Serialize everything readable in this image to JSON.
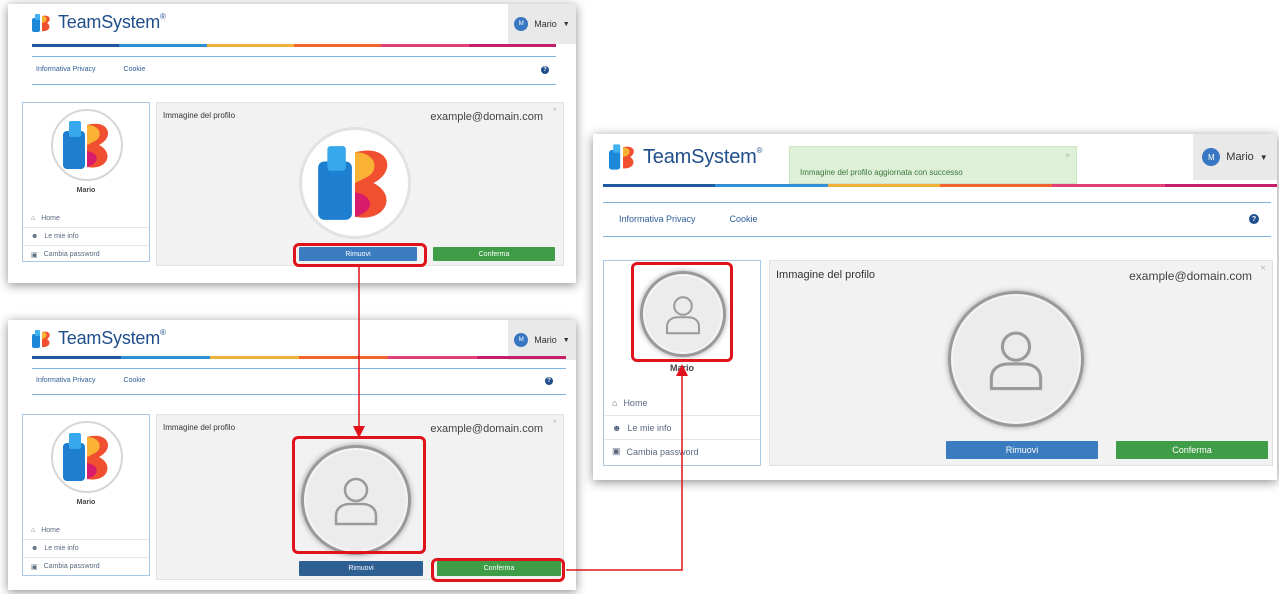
{
  "app": {
    "brand": "TeamSystem",
    "reg_mark": "®",
    "user_initial": "M",
    "user_name": "Mario",
    "caret": "❖"
  },
  "nav": {
    "privacy": "Informativa Privacy",
    "cookie": "Cookie",
    "help": "?"
  },
  "profile": {
    "sidebar_name": "Mario",
    "menu": [
      {
        "icon": "home-icon",
        "label": "Home"
      },
      {
        "icon": "user-icon",
        "label": "Le mie info"
      },
      {
        "icon": "lock-icon",
        "label": "Cambia password"
      }
    ],
    "card_title": "Immagine del profilo",
    "email": "example@domain.com",
    "close": "×",
    "remove_label": "Rimuovi",
    "confirm_label": "Conferma"
  },
  "toast": {
    "message": "Immagine del profilo aggiornata con successo",
    "close": "×"
  },
  "colors": {
    "accent_red": "#e0121b",
    "brand_blue": "#1f4e8c",
    "button_blue": "#3b7bbf",
    "button_green": "#3f9d48"
  }
}
